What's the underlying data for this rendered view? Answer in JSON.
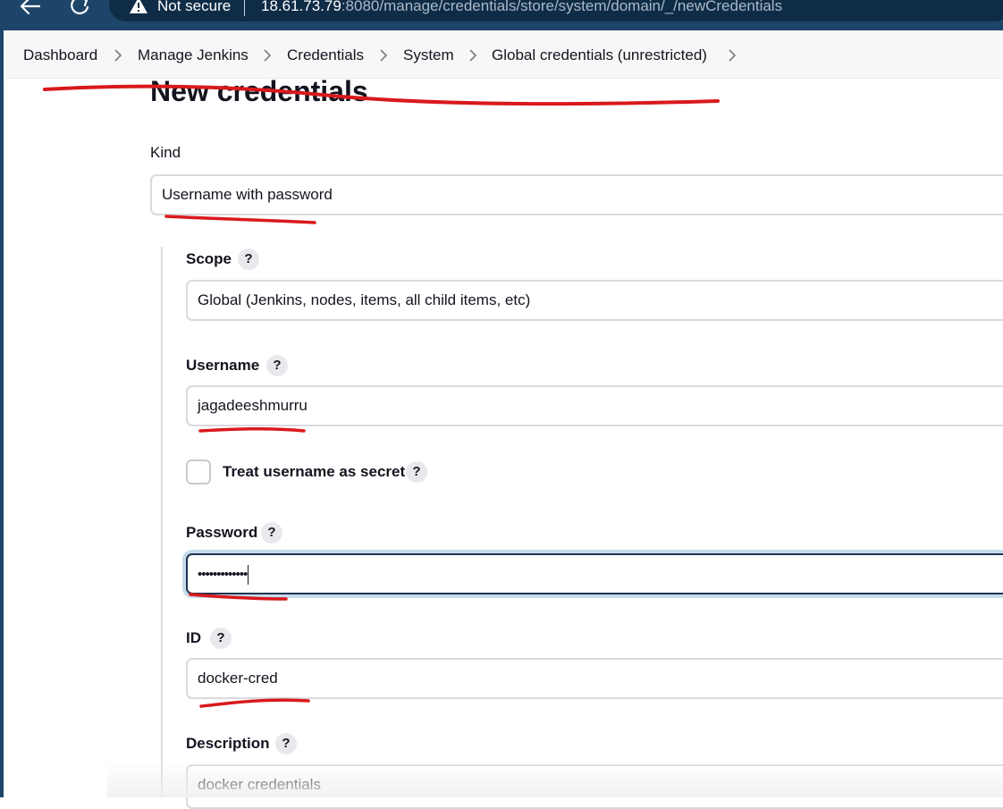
{
  "browser": {
    "security_label": "Not secure",
    "url_host": "18.61.73.79",
    "url_rest": ":8080/manage/credentials/store/system/domain/_/newCredentials"
  },
  "breadcrumb": {
    "items": [
      "Dashboard",
      "Manage Jenkins",
      "Credentials",
      "System",
      "Global credentials (unrestricted)"
    ]
  },
  "page": {
    "title": "New credentials"
  },
  "form": {
    "kind": {
      "label": "Kind",
      "value": "Username with password"
    },
    "scope": {
      "label": "Scope",
      "help": "?",
      "value": "Global (Jenkins, nodes, items, all child items, etc)"
    },
    "username": {
      "label": "Username",
      "help": "?",
      "value": "jagadeeshmurru"
    },
    "treat_secret": {
      "label": "Treat username as secret",
      "help": "?",
      "checked": false
    },
    "password": {
      "label": "Password",
      "help": "?",
      "value": "•••••••••••••"
    },
    "id": {
      "label": "ID",
      "help": "?",
      "value": "docker-cred"
    },
    "description": {
      "label": "Description",
      "help": "?",
      "value": "docker credentials"
    }
  },
  "colors": {
    "browser_bar": "#1d4569",
    "annotation": "#d9191c",
    "focus_ring": "#c5dbea"
  }
}
